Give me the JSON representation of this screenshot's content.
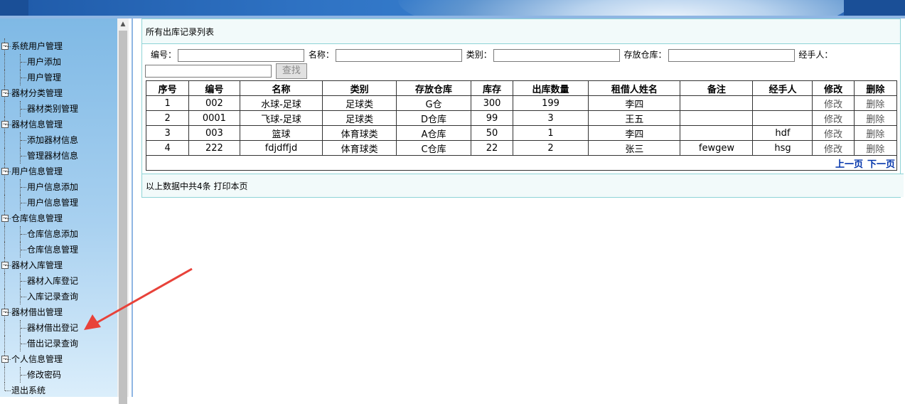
{
  "sidebar": {
    "groups": [
      {
        "label": "系统用户管理",
        "items": [
          "用户添加",
          "用户管理"
        ]
      },
      {
        "label": "器材分类管理",
        "items": [
          "器材类别管理"
        ]
      },
      {
        "label": "器材信息管理",
        "items": [
          "添加器材信息",
          "管理器材信息"
        ]
      },
      {
        "label": "用户信息管理",
        "items": [
          "用户信息添加",
          "用户信息管理"
        ]
      },
      {
        "label": "仓库信息管理",
        "items": [
          "仓库信息添加",
          "仓库信息管理"
        ]
      },
      {
        "label": "器材入库管理",
        "items": [
          "器材入库登记",
          "入库记录查询"
        ]
      },
      {
        "label": "器材借出管理",
        "items": [
          "器材借出登记",
          "借出记录查询"
        ]
      },
      {
        "label": "个人信息管理",
        "items": [
          "修改密码"
        ]
      }
    ],
    "logout": "退出系统"
  },
  "main": {
    "title": "所有出库记录列表",
    "search": {
      "code_label": "编号：",
      "name_label": "名称：",
      "category_label": "类别：",
      "warehouse_label": "存放仓库：",
      "handler_label": "经手人：",
      "button": "查找"
    },
    "table": {
      "headers": [
        "序号",
        "编号",
        "名称",
        "类别",
        "存放仓库",
        "库存",
        "出库数量",
        "租借人姓名",
        "备注",
        "经手人",
        "修改",
        "删除"
      ],
      "rows": [
        [
          "1",
          "002",
          "水球-足球",
          "足球类",
          "G仓",
          "300",
          "199",
          "李四",
          "",
          "",
          "修改",
          "删除"
        ],
        [
          "2",
          "0001",
          "飞球-足球",
          "足球类",
          "D仓库",
          "99",
          "3",
          "王五",
          "",
          "",
          "修改",
          "删除"
        ],
        [
          "3",
          "003",
          "篮球",
          "体育球类",
          "A仓库",
          "50",
          "1",
          "李四",
          "",
          "hdf",
          "修改",
          "删除"
        ],
        [
          "4",
          "222",
          "fdjdffjd",
          "体育球类",
          "C仓库",
          "22",
          "2",
          "张三",
          "fewgew",
          "hsg",
          "修改",
          "删除"
        ]
      ]
    },
    "pager": {
      "prev": "上一页",
      "next": "下一页"
    },
    "footer": {
      "summary": "以上数据中共4条",
      "print": "打印本页"
    }
  },
  "colors": {
    "accent_border": "#8ed4d6",
    "annotation_arrow": "#e8423a",
    "link": "#0033aa"
  }
}
